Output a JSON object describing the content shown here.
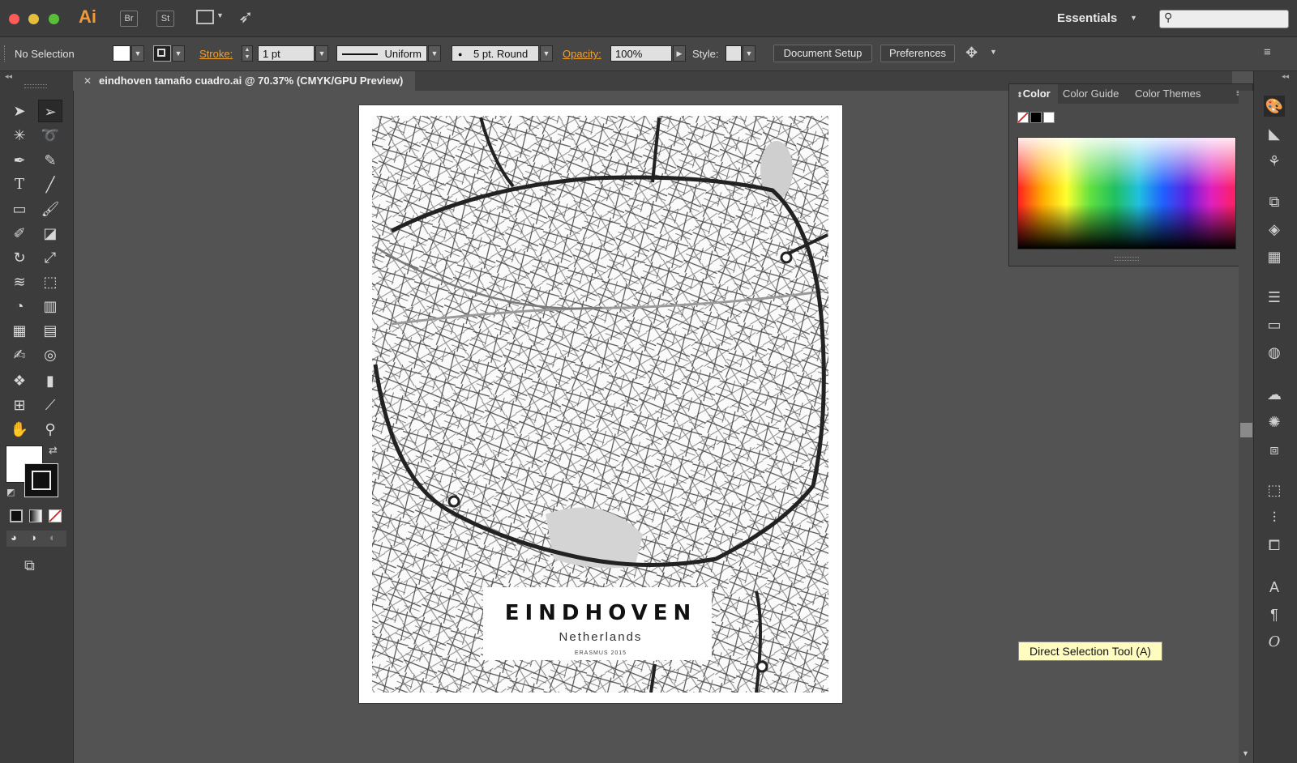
{
  "app": {
    "logo": "Ai",
    "bridge_label": "Br",
    "stock_label": "St",
    "workspace": "Essentials"
  },
  "control": {
    "selection": "No Selection",
    "stroke_label": "Stroke:",
    "stroke_value": "1 pt",
    "profile": "Uniform",
    "brush": "5 pt. Round",
    "opacity_label": "Opacity:",
    "opacity_value": "100%",
    "style_label": "Style:",
    "document_setup": "Document Setup",
    "preferences": "Preferences"
  },
  "document": {
    "tab_title": "eindhoven tamaño cuadro.ai @ 70.37% (CMYK/GPU Preview)",
    "poster_title": "EINDHOVEN",
    "poster_subtitle": "Netherlands",
    "poster_note": "ERASMUS 2015"
  },
  "color_panel": {
    "tabs": [
      "Color",
      "Color Guide",
      "Color Themes"
    ]
  },
  "tooltip": "Direct Selection Tool (A)"
}
